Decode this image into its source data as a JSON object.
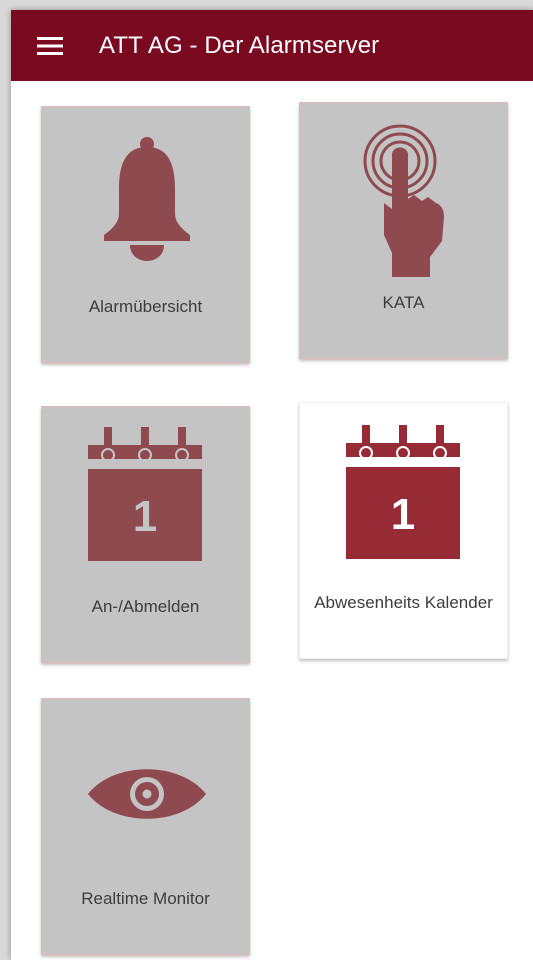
{
  "appbar": {
    "title": "ATT AG - Der Alarmserver",
    "menu_icon": "hamburger-menu-icon",
    "color": "#7a0a20"
  },
  "tiles": [
    {
      "label": "Alarmübersicht",
      "icon": "bell-icon",
      "selected": false
    },
    {
      "label": "KATA",
      "icon": "touch-finger-icon",
      "selected": false
    },
    {
      "label": "An-/Abmelden",
      "icon": "calendar-icon",
      "calendar_day": "1",
      "selected": false
    },
    {
      "label": "Abwesenheits Kalender",
      "icon": "calendar-icon",
      "calendar_day": "1",
      "selected": true
    },
    {
      "label": "Realtime Monitor",
      "icon": "eye-icon",
      "selected": false
    }
  ],
  "colors": {
    "icon_inactive": "#8f4a4f",
    "icon_active": "#962b35",
    "tile_inactive": "#c4c4c4",
    "tile_active": "#ffffff"
  }
}
